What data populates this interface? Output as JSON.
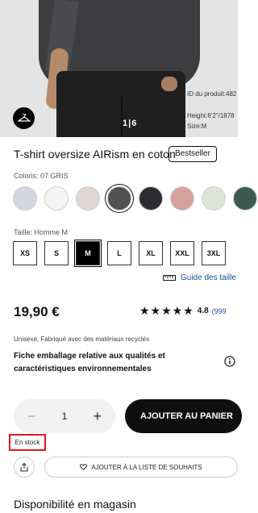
{
  "image": {
    "overlay_line1": "ID du produit:482",
    "overlay_line2": "Height:6'2\"/1878",
    "overlay_line3": "Size:M",
    "pager": "1|6"
  },
  "product": {
    "title": "T-shirt oversize AIRism en coton",
    "badge": "Bestseller",
    "colors_label": "Coloris: 07 GRIS",
    "colors": [
      {
        "hex": "#d3d8e0"
      },
      {
        "hex": "#f4f4f4"
      },
      {
        "hex": "#e0d8d2"
      },
      {
        "hex": "#505153",
        "selected": true
      },
      {
        "hex": "#2b2d33"
      },
      {
        "hex": "#d7a19b"
      },
      {
        "hex": "#dde4d4"
      },
      {
        "hex": "#3c5a52"
      }
    ],
    "size_label": "Taille: Homme M",
    "sizes": [
      {
        "label": "XS"
      },
      {
        "label": "S"
      },
      {
        "label": "M",
        "selected": true
      },
      {
        "label": "L"
      },
      {
        "label": "XL"
      },
      {
        "label": "XXL"
      },
      {
        "label": "3XL"
      }
    ],
    "size_guide": "Guide des taille",
    "price": "19,90 €",
    "stars": "★★★★★",
    "rating": "4.8",
    "rating_count": "(999",
    "tags": "Unisexe,  Fabriqué avec des matériaux recyclés",
    "fiche": "Fiche emballage relative aux qualités et caractéristiques environnementales",
    "quantity": "1",
    "qty_minus": "−",
    "qty_plus": "+",
    "add_to_cart": "AJOUTER AU PANIER",
    "stock": "En stock",
    "wishlist": "AJOUTER À LA LISTE DE SOUHAITS",
    "store_availability": "Disponibilité en magasin"
  },
  "colors": {
    "accent_link": "#1a4e96",
    "stock_highlight": "#e5141a",
    "cta_bg": "#0e0e0e"
  }
}
